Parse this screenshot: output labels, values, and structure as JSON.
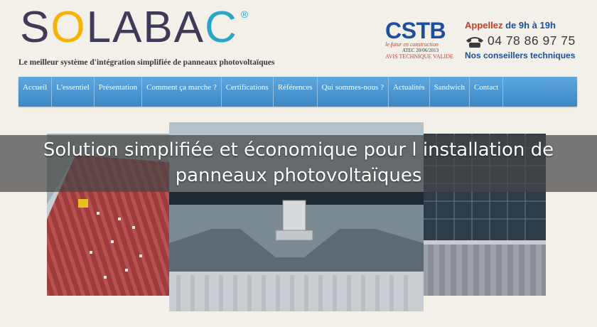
{
  "brand": {
    "logo_part1": "S",
    "logo_part2": "O",
    "logo_part3": "LABA",
    "logo_part4": "C",
    "registered": "®",
    "tagline": "Le meilleur système d'intégration simplifiée de panneaux photovoltaïques"
  },
  "certification": {
    "logo": "CSTB",
    "subtitle": "le futur en construction",
    "atec": "ATEC 20/06/2013",
    "avis": "AVIS TECHNIQUE VALIDE"
  },
  "contact": {
    "hours_prefix": "Appellez",
    "hours_suffix": " de 9h à 19h",
    "phone": "04 78 86 97 75",
    "note": "Nos conseillers techniques",
    "icon": "phone-icon"
  },
  "nav": {
    "items": [
      "Accueil",
      "L'essentiel",
      "Présentation",
      "Comment ça marche ?",
      "Certifications",
      "Références",
      "Qui sommes-nous ?",
      "Actualités",
      "Sandwich",
      "Contact"
    ]
  },
  "hero": {
    "line1": "Solution simplifiée et économique pour l installation de",
    "line2": "panneaux photovoltaïques"
  },
  "colors": {
    "nav_bg": "#4a96d4",
    "brand_dark": "#3f3a57",
    "brand_yellow": "#f4b400",
    "brand_blue": "#2aa4c9",
    "cstb_blue": "#1c4f9c",
    "accent_red": "#c83a2a"
  }
}
